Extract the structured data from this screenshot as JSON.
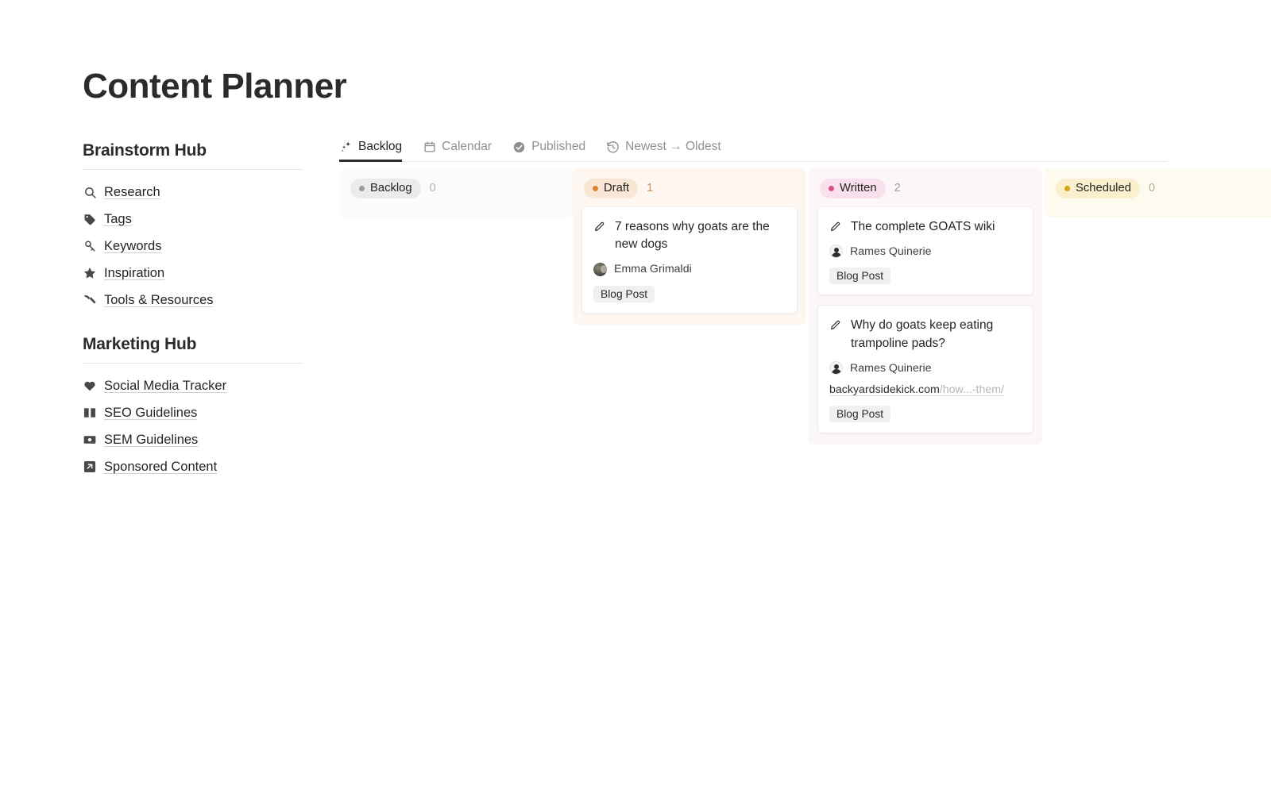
{
  "page": {
    "title": "Content Planner"
  },
  "sidebar": {
    "sections": [
      {
        "heading": "Brainstorm Hub",
        "items": [
          {
            "label": "Research",
            "icon": "search-icon"
          },
          {
            "label": "Tags",
            "icon": "tag-icon"
          },
          {
            "label": "Keywords",
            "icon": "key-icon"
          },
          {
            "label": "Inspiration",
            "icon": "star-icon"
          },
          {
            "label": "Tools & Resources",
            "icon": "hammer-icon"
          }
        ]
      },
      {
        "heading": "Marketing Hub",
        "items": [
          {
            "label": "Social Media Tracker",
            "icon": "heart-icon"
          },
          {
            "label": "SEO Guidelines",
            "icon": "book-icon"
          },
          {
            "label": "SEM Guidelines",
            "icon": "money-icon"
          },
          {
            "label": "Sponsored Content",
            "icon": "external-link-icon"
          }
        ]
      }
    ]
  },
  "board": {
    "tabs": [
      {
        "label": "Backlog",
        "icon": "sparkles-icon",
        "active": true
      },
      {
        "label": "Calendar",
        "icon": "calendar-icon",
        "active": false
      },
      {
        "label": "Published",
        "icon": "check-circle-icon",
        "active": false
      },
      {
        "label": "Newest → Oldest",
        "icon": "history-icon",
        "active": false
      }
    ],
    "columns": [
      {
        "name": "Backlog",
        "count": "0",
        "pill_bg": "#ebebeb",
        "dot_color": "#9a9a9a",
        "count_color": "#b5b5b5",
        "column_bg": "#fbfbfb",
        "cards": []
      },
      {
        "name": "Draft",
        "count": "1",
        "pill_bg": "#fae6d5",
        "dot_color": "#d9862e",
        "count_color": "#c98f5c",
        "column_bg": "#fdf6f1",
        "cards": [
          {
            "icon": "pencil-icon",
            "title": "7 reasons why goats are the new dogs",
            "author": "Emma Grimaldi",
            "avatar": "photo",
            "url_domain": "",
            "url_path": "",
            "tag": "Blog Post"
          }
        ]
      },
      {
        "name": "Written",
        "count": "2",
        "pill_bg": "#fae0ec",
        "dot_color": "#d9528f",
        "count_color": "#9d9d9d",
        "column_bg": "#fdf6f8",
        "cards": [
          {
            "icon": "pencil-icon",
            "title": "The complete GOATS wiki",
            "author": "Rames Quinerie",
            "avatar": "silhouette",
            "url_domain": "",
            "url_path": "",
            "tag": "Blog Post"
          },
          {
            "icon": "pencil-icon",
            "title": "Why do goats keep eating trampoline pads?",
            "author": "Rames Quinerie",
            "avatar": "silhouette",
            "url_domain": "backyardsidekick.com",
            "url_path": "/how...-them/",
            "tag": "Blog Post"
          }
        ]
      },
      {
        "name": "Scheduled",
        "count": "0",
        "pill_bg": "#fbf0cd",
        "dot_color": "#d6a315",
        "count_color": "#b7ae8a",
        "column_bg": "#fdfaf0",
        "cards": []
      }
    ]
  }
}
